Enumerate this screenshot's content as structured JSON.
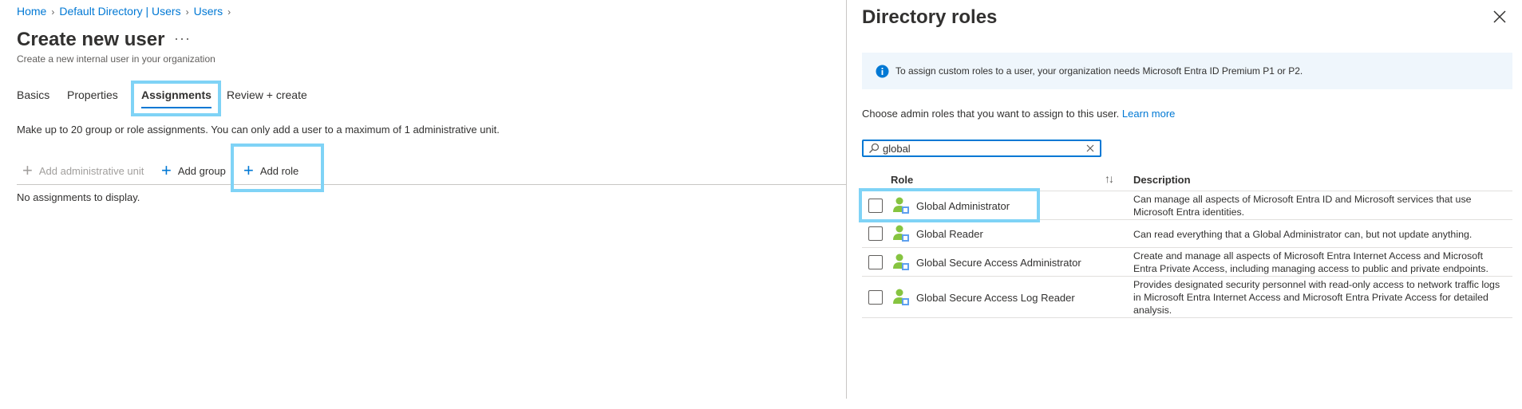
{
  "breadcrumb": {
    "items": [
      "Home",
      "Default Directory | Users",
      "Users"
    ]
  },
  "page": {
    "title": "Create new user",
    "more_label": "···",
    "subtitle": "Create a new internal user in your organization"
  },
  "tabs": [
    {
      "label": "Basics"
    },
    {
      "label": "Properties"
    },
    {
      "label": "Assignments"
    },
    {
      "label": "Review + create"
    }
  ],
  "assignments": {
    "info": "Make up to 20 group or role assignments. You can only add a user to a maximum of 1 administrative unit.",
    "commands": {
      "add_admin_unit": "Add administrative unit",
      "add_group": "Add group",
      "add_role": "Add role"
    },
    "empty_message": "No assignments to display."
  },
  "panel": {
    "title": "Directory roles",
    "banner": "To assign custom roles to a user, your organization needs Microsoft Entra ID Premium P1 or P2.",
    "choose_text": "Choose admin roles that you want to assign to this user.",
    "learn_more": "Learn more",
    "search": {
      "value": "global"
    },
    "columns": {
      "role": "Role",
      "description": "Description"
    },
    "rows": [
      {
        "role": "Global Administrator",
        "description": "Can manage all aspects of Microsoft Entra ID and Microsoft services that use Microsoft Entra identities."
      },
      {
        "role": "Global Reader",
        "description": "Can read everything that a Global Administrator can, but not update anything."
      },
      {
        "role": "Global Secure Access Administrator",
        "description": "Create and manage all aspects of Microsoft Entra Internet Access and Microsoft Entra Private Access, including managing access to public and private endpoints."
      },
      {
        "role": "Global Secure Access Log Reader",
        "description": "Provides designated security personnel with read-only access to network traffic logs in Microsoft Entra Internet Access and Microsoft Entra Private Access for detailed analysis."
      }
    ]
  },
  "colors": {
    "accent": "#0078d4",
    "highlight": "#7fd3f6",
    "banner_bg": "#eff6fc"
  }
}
